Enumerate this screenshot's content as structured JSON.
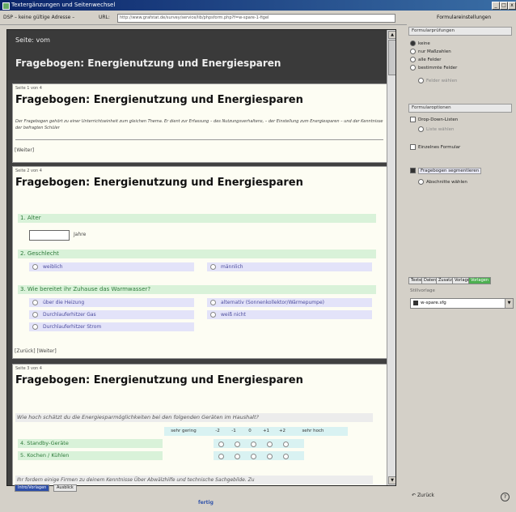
{
  "window": {
    "title": "Textergänzungen und Seitenwechsel",
    "controls": [
      "_",
      "□",
      "x"
    ]
  },
  "urlbar": {
    "dsp_label": "DSP – keine gültige Adresse –",
    "url_label": "URL:",
    "url_value": "http://www.grafstat.de/survey/service/lib/phpsform.php?f=w-spare-1-figel",
    "panel_header": "Formulareinstellungen"
  },
  "preview": {
    "top_page": {
      "label": "Seite: vom",
      "title": "Fragebogen: Energienutzung und Energiesparen"
    },
    "page1": {
      "num": "Seite 1 von 4",
      "title": "Fragebogen: Energienutzung und Energiesparen",
      "intro": "Der Fragebogen gehört zu einer Unterrichtseinheit zum gleichen Thema. Er dient zur Erfassung – des Nutzungsverhaltens, – der Einstellung zum Energiesparen – und der Kenntnisse der befragten Schüler",
      "nav": "[Weiter]"
    },
    "page2": {
      "num": "Seite 2 von 4",
      "title": "Fragebogen: Energienutzung und Energiesparen",
      "q1": "1. Alter",
      "q1_unit": "Jahre",
      "q2": "2. Geschlecht",
      "q2_options": [
        "weiblich",
        "männlich"
      ],
      "q3": "3. Wie bereitet ihr Zuhause das Warmwasser?",
      "q3_options_left": [
        "über die Heizung",
        "Durchlauferhitzer Gas",
        "Durchlauferhitzer Strom"
      ],
      "q3_options_right": [
        "alternativ (Sonnenkollektor/Wärmepumpe)",
        "weiß nicht"
      ],
      "nav": "[Zurück] [Weiter]"
    },
    "page3": {
      "num": "Seite 3 von 4",
      "title": "Fragebogen: Energienutzung und Energiesparen",
      "question": "Wie hoch schätzt du die Energiesparmöglichkeiten bei den folgenden Geräten im Haushalt?",
      "scale": [
        "sehr gering",
        "-2",
        "-1",
        "0",
        "+1",
        "+2",
        "sehr hoch"
      ],
      "rows": [
        "4. Standby-Geräte",
        "5. Kochen / Kühlen"
      ],
      "footer_text": "Ihr fordern einige Firmen zu deinem Kenntnisse Über Abwälzhilfe und technische Sachgebilde. Zu"
    }
  },
  "bottom_tabs": [
    "Intro/Vorlagen",
    "Ausblick"
  ],
  "done_link": "fertig",
  "panel": {
    "group1": {
      "title": "Formularprüfungen",
      "items": [
        "keine",
        "nur Maßzahlen",
        "alle Felder",
        "bestimmte Felder"
      ],
      "sub": "Felder wählen"
    },
    "group2": {
      "title": "Formularoptionen",
      "items": [
        "Drop-Down-Listen",
        "Einzelnes Formular"
      ],
      "sub": "Liste wählen"
    },
    "paging": {
      "label": "Fragebogen segmentieren",
      "button": "Abschnitte wählen"
    },
    "tabs": [
      "Texte",
      "Daten",
      "Zusatz",
      "Vorlage",
      "Vorlagen"
    ],
    "preset_label": "Stillvorlage",
    "preset_value": "w-spare.sfg",
    "back": "Zurück",
    "help_icon_text": "?"
  }
}
